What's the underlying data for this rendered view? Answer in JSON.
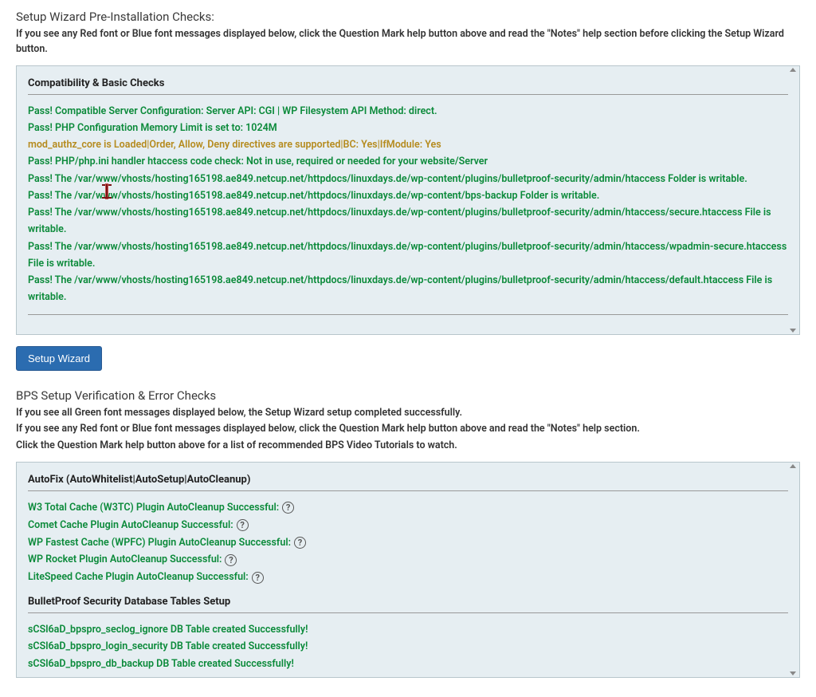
{
  "preinstall": {
    "title": "Setup Wizard Pre-Installation Checks:",
    "desc": "If you see any Red font or Blue font messages displayed below, click the Question Mark help button above and read the \"Notes\" help section before clicking the Setup Wizard button.",
    "panel_title": "Compatibility & Basic Checks",
    "checks": [
      {
        "type": "pass",
        "text": "Pass! Compatible Server Configuration: Server API: CGI | WP Filesystem API Method: direct."
      },
      {
        "type": "pass",
        "text": "Pass! PHP Configuration Memory Limit is set to: 1024M"
      },
      {
        "type": "warn",
        "text": "mod_authz_core is Loaded|Order, Allow, Deny directives are supported|BC: Yes|IfModule: Yes"
      },
      {
        "type": "pass",
        "text": "Pass! PHP/php.ini handler htaccess code check: Not in use, required or needed for your website/Server"
      },
      {
        "type": "pass",
        "text": "Pass! The /var/www/vhosts/hosting165198.ae849.netcup.net/httpdocs/linuxdays.de/wp-content/plugins/bulletproof-security/admin/htaccess Folder is writable."
      },
      {
        "type": "pass",
        "text": "Pass! The /var/www/vhosts/hosting165198.ae849.netcup.net/httpdocs/linuxdays.de/wp-content/bps-backup Folder is writable."
      },
      {
        "type": "pass",
        "text": "Pass! The /var/www/vhosts/hosting165198.ae849.netcup.net/httpdocs/linuxdays.de/wp-content/plugins/bulletproof-security/admin/htaccess/secure.htaccess File is writable."
      },
      {
        "type": "pass",
        "text": "Pass! The /var/www/vhosts/hosting165198.ae849.netcup.net/httpdocs/linuxdays.de/wp-content/plugins/bulletproof-security/admin/htaccess/wpadmin-secure.htaccess File is writable."
      },
      {
        "type": "pass",
        "text": "Pass! The /var/www/vhosts/hosting165198.ae849.netcup.net/httpdocs/linuxdays.de/wp-content/plugins/bulletproof-security/admin/htaccess/default.htaccess File is writable."
      }
    ]
  },
  "setup_wizard_button": "Setup Wizard",
  "verify": {
    "title": "BPS Setup Verification & Error Checks",
    "desc1": "If you see all Green font messages displayed below, the Setup Wizard setup completed successfully.",
    "desc2": "If you see any Red font or Blue font messages displayed below, click the Question Mark help button above and read the \"Notes\" help section.",
    "desc3": "Click the Question Mark help button above for a list of recommended BPS Video Tutorials to watch.",
    "panel_title": "AutoFix (AutoWhitelist|AutoSetup|AutoCleanup)",
    "autofix": [
      "W3 Total Cache (W3TC) Plugin AutoCleanup Successful:",
      "Comet Cache Plugin AutoCleanup Successful:",
      "WP Fastest Cache (WPFC) Plugin AutoCleanup Successful:",
      "WP Rocket Plugin AutoCleanup Successful:",
      "LiteSpeed Cache Plugin AutoCleanup Successful:"
    ],
    "db_title": "BulletProof Security Database Tables Setup",
    "db_rows": [
      "sCSl6aD_bpspro_seclog_ignore DB Table created Successfully!",
      "sCSl6aD_bpspro_login_security DB Table created Successfully!",
      "sCSl6aD_bpspro_db_backup DB Table created Successfully!"
    ],
    "qmark": "?"
  }
}
